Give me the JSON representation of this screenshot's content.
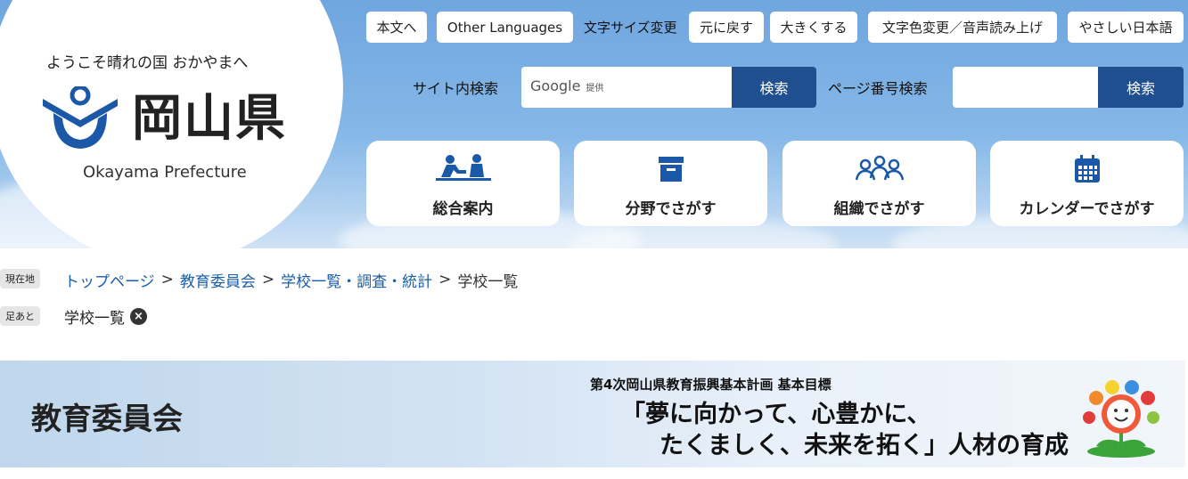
{
  "header": {
    "tagline": "ようこそ晴れの国 おかやまへ",
    "logo_name": "岡山県",
    "logo_en": "Okayama Prefecture",
    "util": {
      "skip_to_content": "本文へ",
      "other_languages": "Other Languages",
      "font_size_label": "文字サイズ変更",
      "reset": "元に戻す",
      "enlarge": "大きくする",
      "color_voice": "文字色変更／音声読み上げ",
      "easy_japanese": "やさしい日本語"
    },
    "site_search": {
      "label": "サイト内検索",
      "google_text": "Google",
      "provided_text": "提供",
      "button": "検索"
    },
    "page_search": {
      "label": "ページ番号検索",
      "button": "検索"
    },
    "nav": [
      {
        "label": "総合案内",
        "icon": "people-desk-icon"
      },
      {
        "label": "分野でさがす",
        "icon": "box-icon"
      },
      {
        "label": "組織でさがす",
        "icon": "group-icon"
      },
      {
        "label": "カレンダーでさがす",
        "icon": "calendar-icon"
      }
    ]
  },
  "breadcrumb": {
    "tag": "現在地",
    "items": [
      "トップページ",
      "教育委員会",
      "学校一覧・調査・統計"
    ],
    "separator": ">",
    "current": "学校一覧"
  },
  "footprint": {
    "tag": "足あと",
    "item": "学校一覧"
  },
  "banner": {
    "title": "教育委員会",
    "subtitle": "第4次岡山県教育振興基本計画 基本目標",
    "line1": "「夢に向かって、心豊かに、",
    "line2": "たくましく、未来を拓く」人材の育成"
  },
  "colors": {
    "accent_button": "#1f4f8f",
    "logo_blue": "#1b59a8",
    "link": "#1a5ea8"
  }
}
